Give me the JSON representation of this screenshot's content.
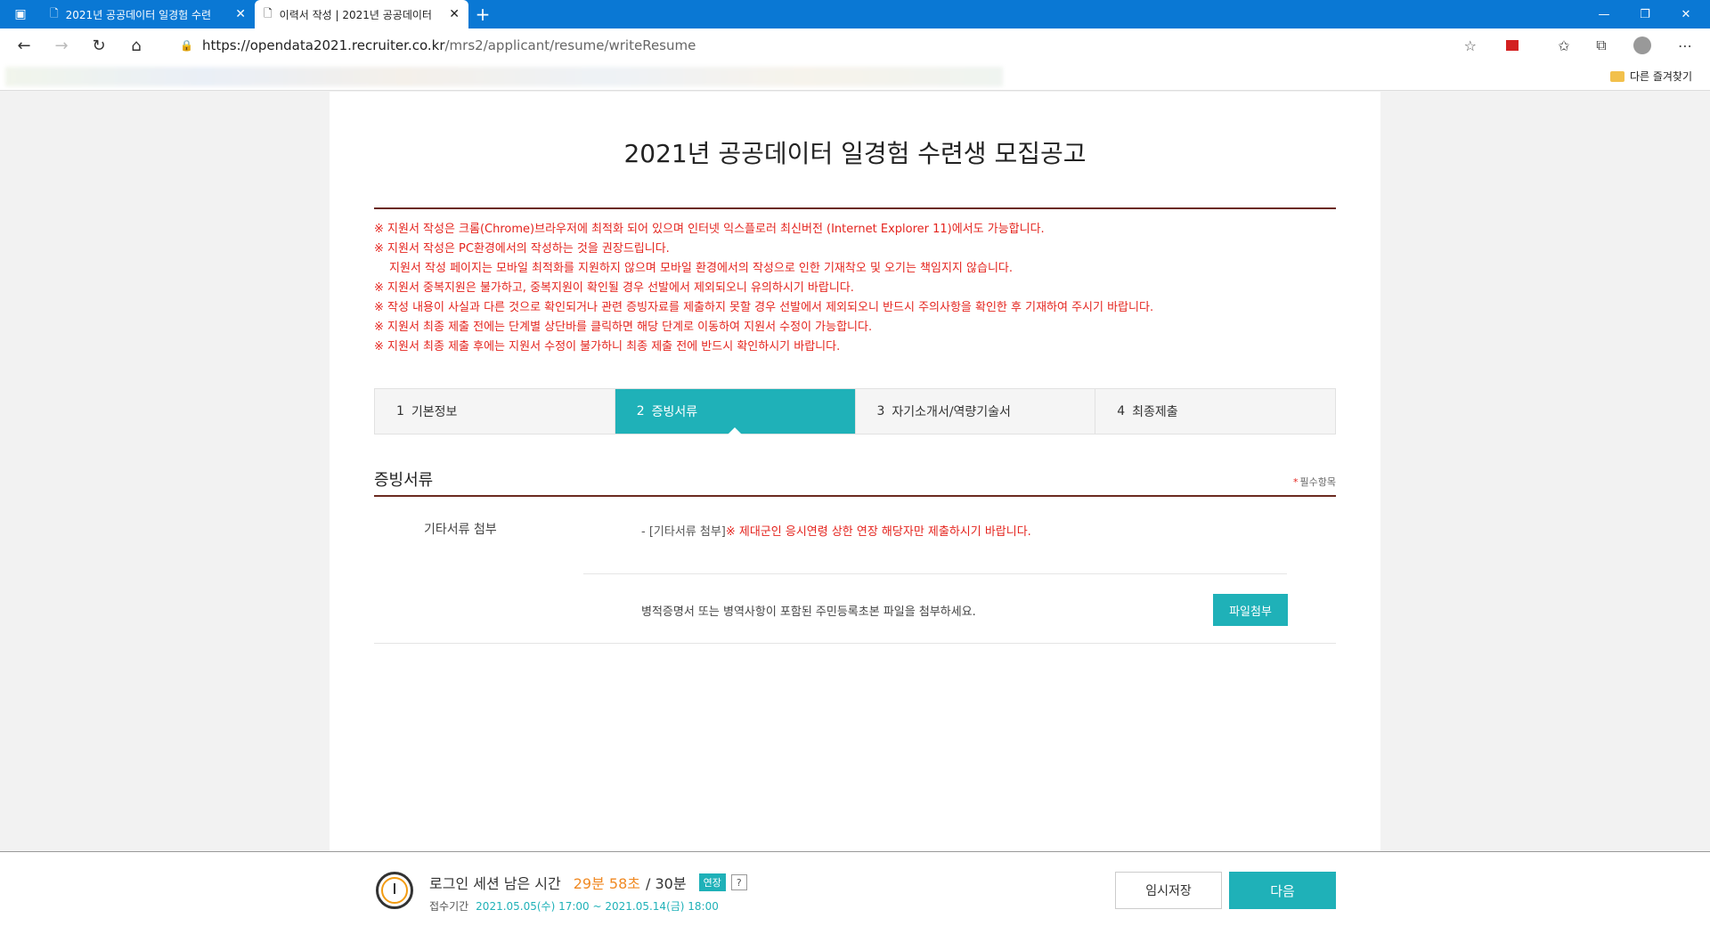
{
  "browser": {
    "tabs": [
      {
        "title": "2021년 공공데이터 일경험 수련"
      },
      {
        "title": "이력서 작성 | 2021년 공공데이터"
      }
    ],
    "url_domain": "https://opendata2021.recruiter.co.kr",
    "url_path": "/mrs2/applicant/resume/writeResume",
    "other_favorites": "다른 즐겨찾기"
  },
  "page": {
    "title": "2021년 공공데이터 일경험 수련생 모집공고",
    "notices": [
      "※ 지원서 작성은 크롬(Chrome)브라우저에 최적화 되어 있으며 인터넷 익스플로러 최신버전 (Internet Explorer 11)에서도 가능합니다.",
      "※ 지원서 작성은 PC환경에서의 작성하는 것을 권장드립니다.",
      "지원서 작성 페이지는 모바일 최적화를 지원하지 않으며 모바일 환경에서의 작성으로 인한 기재착오 및 오기는 책임지지 않습니다.",
      "※ 지원서 중복지원은 불가하고, 중복지원이 확인될 경우 선발에서 제외되오니 유의하시기 바랍니다.",
      "※ 작성 내용이 사실과 다른 것으로 확인되거나 관련 증빙자료를 제출하지 못할 경우 선발에서 제외되오니 반드시 주의사항을 확인한 후 기재하여 주시기 바랍니다.",
      "※ 지원서 최종 제출 전에는 단계별 상단바를 클릭하면 해당 단계로 이동하여 지원서 수정이 가능합니다.",
      "※ 지원서 최종 제출 후에는 지원서 수정이 불가하니 최종 제출 전에 반드시 확인하시기 바랍니다."
    ],
    "steps": [
      {
        "num": "1",
        "label": "기본정보"
      },
      {
        "num": "2",
        "label": "증빙서류"
      },
      {
        "num": "3",
        "label": "자기소개서/역량기술서"
      },
      {
        "num": "4",
        "label": "최종제출"
      }
    ],
    "section_title": "증빙서류",
    "required_star": "*",
    "required_label": "필수항목",
    "row_label": "기타서류 첨부",
    "desc_prefix": "- [기타서류 첨부]",
    "desc_red": "※ 제대군인 응시연령 상한 연장 해당자만 제출하시기 바랍니다.",
    "file_text": "병적증명서 또는 병역사항이 포함된 주민등록초본 파일을 첨부하세요.",
    "file_button": "파일첨부"
  },
  "footer": {
    "session_label": "로그인 세션 남은 시간",
    "session_remaining": "29분 58초",
    "session_total": "/ 30분",
    "extend": "연장",
    "help": "?",
    "period_label": "접수기간",
    "period_value": "2021.05.05(수) 17:00 ~ 2021.05.14(금) 18:00",
    "save_button": "임시저장",
    "next_button": "다음"
  }
}
